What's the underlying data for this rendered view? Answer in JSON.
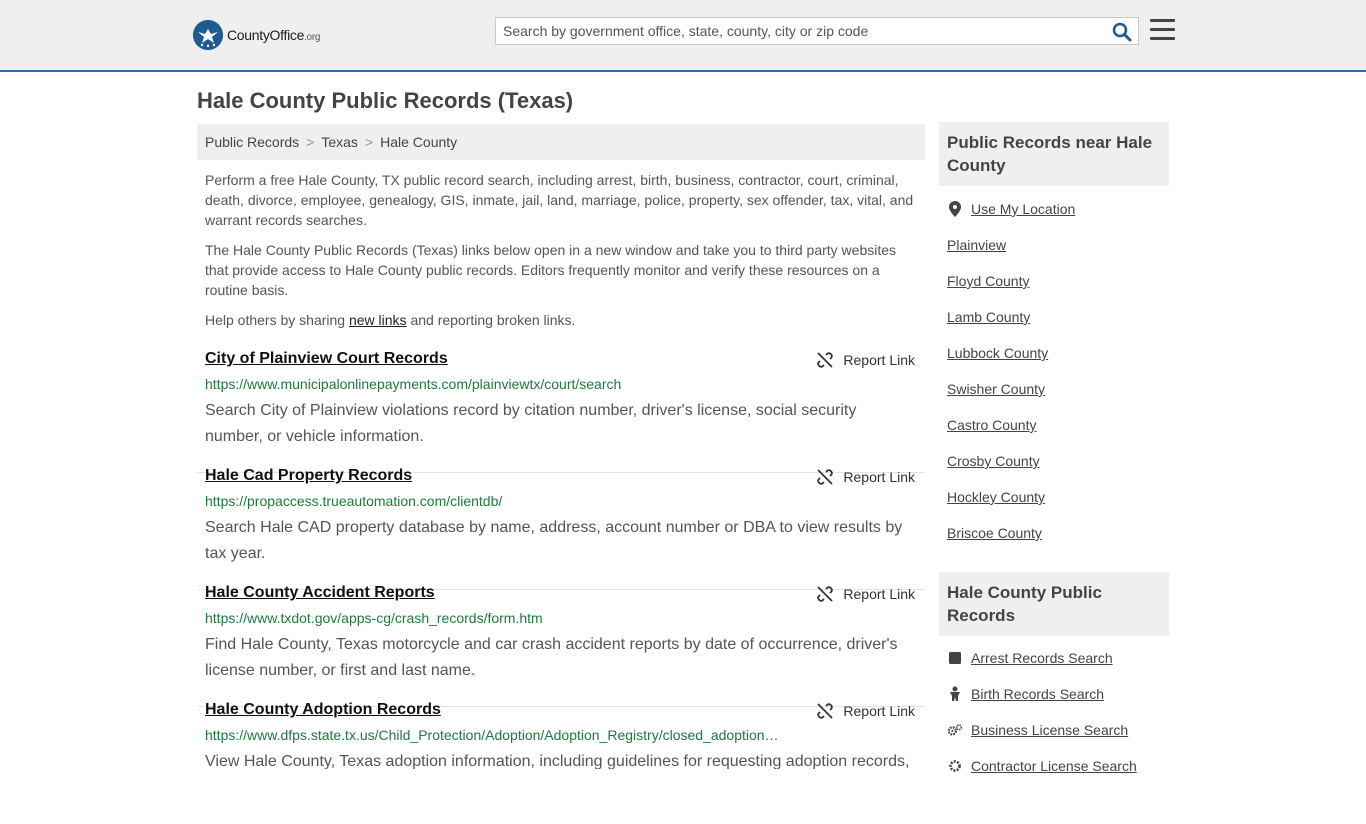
{
  "header": {
    "logo_text_main": "CountyOffice",
    "logo_text_tld": ".org",
    "search_placeholder": "Search by government office, state, county, city or zip code"
  },
  "page": {
    "title": "Hale County Public Records (Texas)"
  },
  "breadcrumb": [
    {
      "label": "Public Records"
    },
    {
      "label": "Texas"
    },
    {
      "label": "Hale County"
    }
  ],
  "intro": {
    "p1": "Perform a free Hale County, TX public record search, including arrest, birth, business, contractor, court, criminal, death, divorce, employee, genealogy, GIS, inmate, jail, land, marriage, police, property, sex offender, tax, vital, and warrant records searches.",
    "p2": "The Hale County Public Records (Texas) links below open in a new window and take you to third party websites that provide access to Hale County public records. Editors frequently monitor and verify these resources on a routine basis.",
    "p3_before": "Help others by sharing ",
    "p3_link": "new links",
    "p3_after": " and reporting broken links."
  },
  "report_label": "Report Link",
  "listings": [
    {
      "title": "City of Plainview Court Records",
      "url": "https://www.municipalonlinepayments.com/plainviewtx/court/search",
      "desc": "Search City of Plainview violations record by citation number, driver's license, social security number, or vehicle information."
    },
    {
      "title": "Hale Cad Property Records",
      "url": "https://propaccess.trueautomation.com/clientdb/",
      "desc": "Search Hale CAD property database by name, address, account number or DBA to view results by tax year."
    },
    {
      "title": "Hale County Accident Reports",
      "url": "https://www.txdot.gov/apps-cg/crash_records/form.htm",
      "desc": "Find Hale County, Texas motorcycle and car crash accident reports by date of occurrence, driver's license number, or first and last name."
    },
    {
      "title": "Hale County Adoption Records",
      "url": "https://www.dfps.state.tx.us/Child_Protection/Adoption/Adoption_Registry/closed_adoption…",
      "desc": "View Hale County, Texas adoption information, including guidelines for requesting adoption records,"
    }
  ],
  "sidebar": {
    "nearby_heading": "Public Records near Hale County",
    "nearby": [
      {
        "label": "Use My Location",
        "icon": "map-pin-icon"
      },
      {
        "label": "Plainview"
      },
      {
        "label": "Floyd County"
      },
      {
        "label": "Lamb County"
      },
      {
        "label": "Lubbock County"
      },
      {
        "label": "Swisher County"
      },
      {
        "label": "Castro County"
      },
      {
        "label": "Crosby County"
      },
      {
        "label": "Hockley County"
      },
      {
        "label": "Briscoe County"
      }
    ],
    "records_heading": "Hale County Public Records",
    "records": [
      {
        "label": "Arrest Records Search",
        "icon": "square-icon"
      },
      {
        "label": "Birth Records Search",
        "icon": "baby-icon"
      },
      {
        "label": "Business License Search",
        "icon": "gears-icon"
      },
      {
        "label": "Contractor License Search",
        "icon": "gear-icon"
      }
    ]
  },
  "colors": {
    "accent_blue": "#2e6da4",
    "url_green": "#1e7a3c",
    "panel_gray": "#efefef"
  }
}
